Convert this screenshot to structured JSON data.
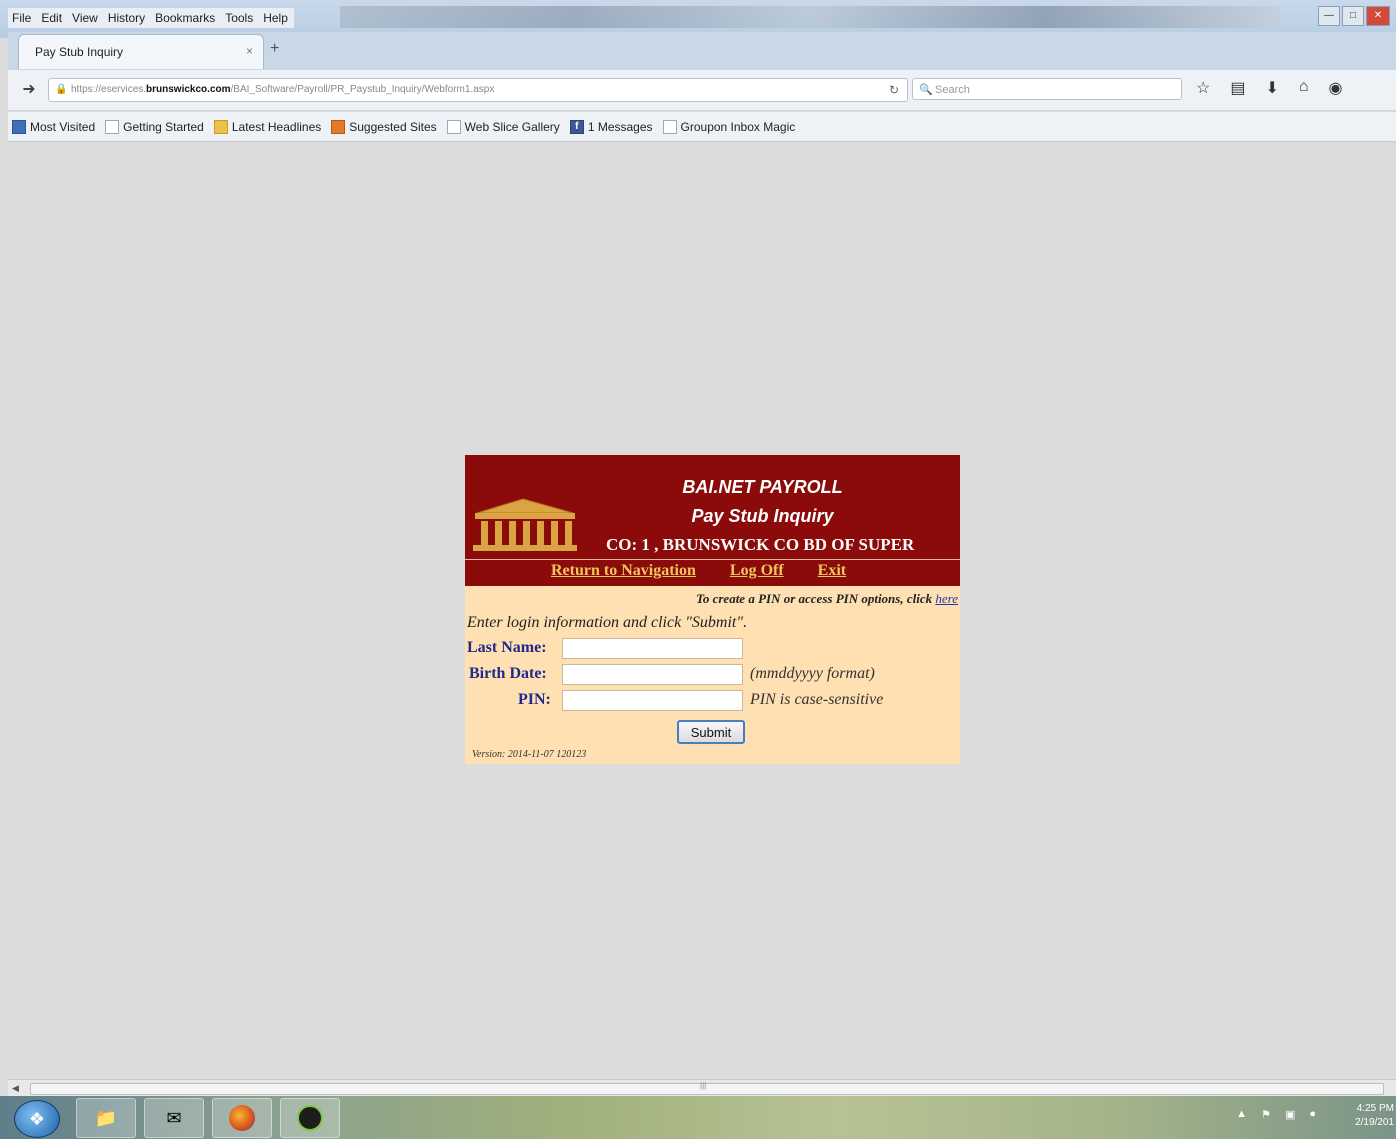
{
  "menubar": {
    "items": [
      "File",
      "Edit",
      "View",
      "History",
      "Bookmarks",
      "Tools",
      "Help"
    ]
  },
  "tab": {
    "title": "Pay Stub Inquiry",
    "close": "×",
    "new_tab": "+"
  },
  "navbar": {
    "url_prefix": "https://eservices.",
    "url_domain": "brunswickco.com",
    "url_path": "/BAI_Software/Payroll/PR_Paystub_Inquiry/Webform1.aspx",
    "search_placeholder": "Search"
  },
  "bookmarks": [
    "Most Visited",
    "Getting Started",
    "Latest Headlines",
    "Suggested Sites",
    "Web Slice Gallery",
    "1 Messages",
    "Groupon Inbox Magic"
  ],
  "page": {
    "header_line1": "BAI.NET PAYROLL",
    "header_line2": "Pay Stub Inquiry",
    "company": "CO: 1 , BRUNSWICK CO BD OF SUPER",
    "links": {
      "navigation": "Return to Navigation",
      "logoff": "Log Off",
      "exit": "Exit"
    },
    "pin_note": "To create a PIN or access PIN options, click ",
    "pin_link": "here",
    "instructions": "Enter login information and click \"Submit\".",
    "fields": {
      "last_name_label": "Last Name:",
      "birth_date_label": "Birth Date:",
      "birth_date_hint": "(mmddyyyy format)",
      "pin_label": "PIN:",
      "pin_hint": "PIN is case-sensitive"
    },
    "submit_label": "Submit",
    "version": "Version: 2014-11-07 120123"
  },
  "taskbar": {
    "time": "4:25 PM",
    "date": "2/19/201"
  },
  "colors": {
    "header_bg": "#8b0a0a",
    "form_bg": "#ffe0b2",
    "link_gold": "#f0c85a",
    "label_blue": "#1f2a8c"
  }
}
